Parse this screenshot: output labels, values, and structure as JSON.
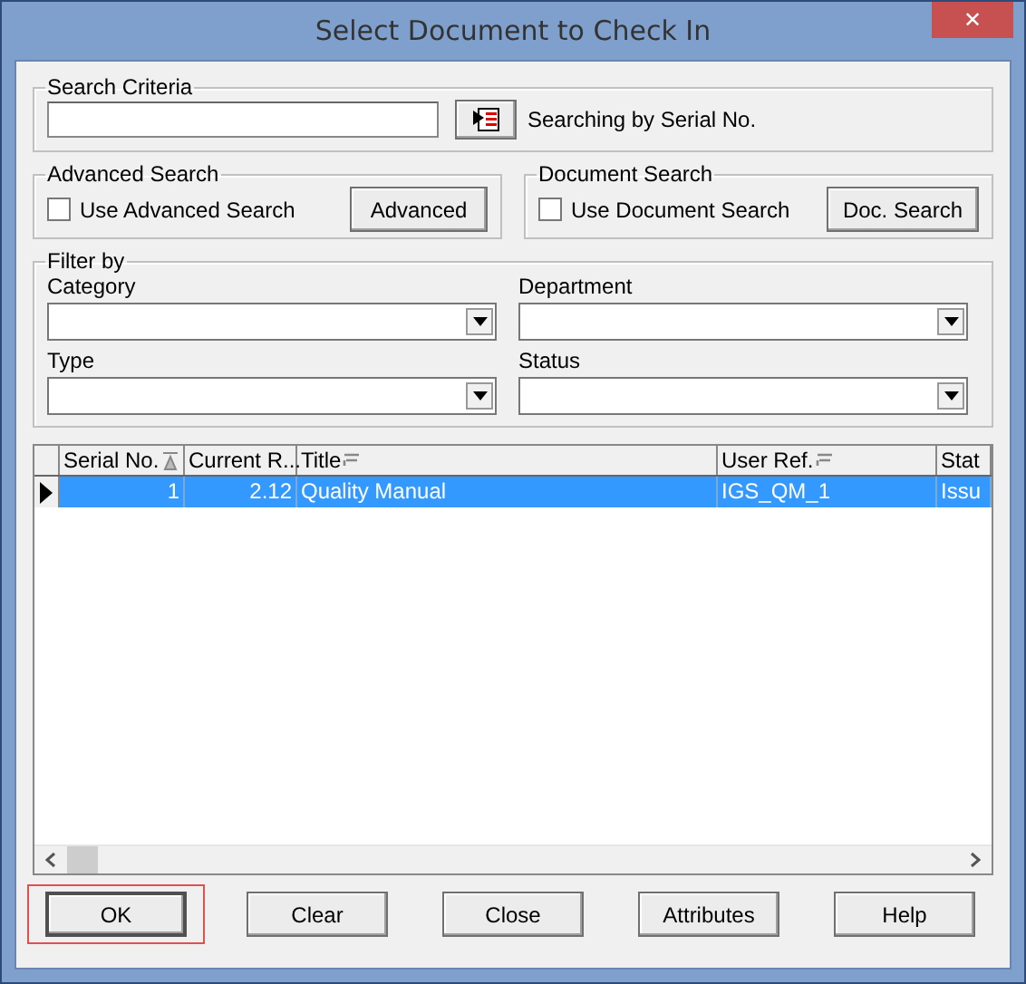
{
  "window": {
    "title": "Select Document to Check In",
    "close_label": "✕"
  },
  "search_criteria": {
    "legend": "Search Criteria",
    "mode_text": "Searching by Serial No."
  },
  "advanced_search": {
    "legend": "Advanced Search",
    "checkbox": {
      "label": "Use Advanced Search",
      "checked": false
    },
    "button": "Advanced"
  },
  "document_search": {
    "legend": "Document Search",
    "checkbox": {
      "label": "Use Document Search",
      "checked": false
    },
    "button": "Doc. Search"
  },
  "filter": {
    "legend": "Filter by",
    "fields": [
      {
        "label": "Category"
      },
      {
        "label": "Department"
      },
      {
        "label": "Type"
      },
      {
        "label": "Status"
      }
    ]
  },
  "table": {
    "columns": [
      {
        "label": "Serial No.",
        "kind": "sorted"
      },
      {
        "label": "Current R...",
        "kind": "plain"
      },
      {
        "label": "Title",
        "kind": "filterable"
      },
      {
        "label": "User Ref.",
        "kind": "filterable"
      },
      {
        "label": "Stat",
        "kind": "plain"
      }
    ],
    "rows": [
      {
        "selected": true,
        "cells": [
          "1",
          "2.12",
          "Quality Manual",
          "IGS_QM_1",
          "Issu"
        ]
      }
    ]
  },
  "buttons": [
    {
      "label": "OK",
      "highlighted": true
    },
    {
      "label": "Clear",
      "highlighted": false
    },
    {
      "label": "Close",
      "highlighted": false
    },
    {
      "label": "Attributes",
      "highlighted": false
    },
    {
      "label": "Help",
      "highlighted": false
    }
  ]
}
